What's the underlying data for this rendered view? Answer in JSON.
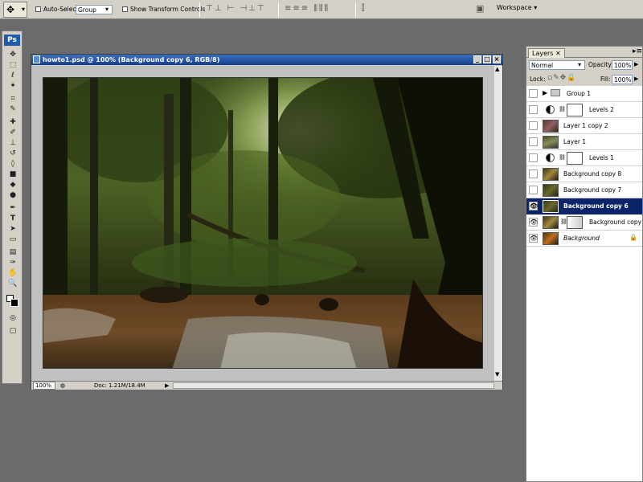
{
  "options_bar": {
    "auto_select_label": "Auto-Select:",
    "auto_select_value": "Group",
    "show_transform_label": "Show Transform Controls",
    "workspace_label": "Workspace"
  },
  "toolbox": {
    "logo": "Ps"
  },
  "document": {
    "title": "howto1.psd @ 100% (Background copy 6, RGB/8)",
    "zoom": "100%",
    "doc_info": "Doc: 1.21M/18.4M"
  },
  "layers_panel": {
    "tab_label": "Layers",
    "blend_mode": "Normal",
    "opacity_label": "Opacity:",
    "opacity_value": "100%",
    "lock_label": "Lock:",
    "fill_label": "Fill:",
    "fill_value": "100%",
    "layers": [
      {
        "name": "Group 1",
        "type": "group"
      },
      {
        "name": "Levels 2",
        "type": "adjustment"
      },
      {
        "name": "Layer 1 copy 2",
        "type": "image"
      },
      {
        "name": "Layer 1",
        "type": "image"
      },
      {
        "name": "Levels 1",
        "type": "adjustment"
      },
      {
        "name": "Background copy 8",
        "type": "image"
      },
      {
        "name": "Background copy 7",
        "type": "image"
      },
      {
        "name": "Background copy 6",
        "type": "image",
        "selected": true,
        "visible": true
      },
      {
        "name": "Background copy",
        "type": "masked",
        "visible": true
      },
      {
        "name": "Background",
        "type": "locked",
        "visible": true
      }
    ]
  },
  "colors": {
    "titlebar": "#163f8a",
    "selection": "#0a246a",
    "workspace_bg": "#6b6b6b"
  }
}
